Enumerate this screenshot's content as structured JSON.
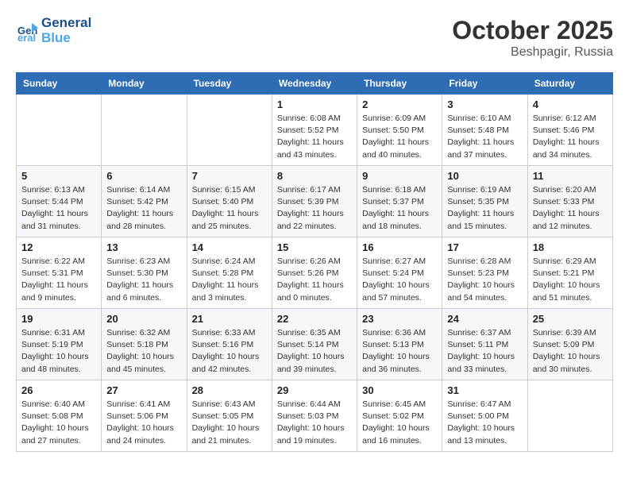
{
  "header": {
    "logo_line1": "General",
    "logo_line2": "Blue",
    "month_title": "October 2025",
    "subtitle": "Beshpagir, Russia"
  },
  "weekdays": [
    "Sunday",
    "Monday",
    "Tuesday",
    "Wednesday",
    "Thursday",
    "Friday",
    "Saturday"
  ],
  "weeks": [
    [
      {
        "day": "",
        "info": ""
      },
      {
        "day": "",
        "info": ""
      },
      {
        "day": "",
        "info": ""
      },
      {
        "day": "1",
        "info": "Sunrise: 6:08 AM\nSunset: 5:52 PM\nDaylight: 11 hours\nand 43 minutes."
      },
      {
        "day": "2",
        "info": "Sunrise: 6:09 AM\nSunset: 5:50 PM\nDaylight: 11 hours\nand 40 minutes."
      },
      {
        "day": "3",
        "info": "Sunrise: 6:10 AM\nSunset: 5:48 PM\nDaylight: 11 hours\nand 37 minutes."
      },
      {
        "day": "4",
        "info": "Sunrise: 6:12 AM\nSunset: 5:46 PM\nDaylight: 11 hours\nand 34 minutes."
      }
    ],
    [
      {
        "day": "5",
        "info": "Sunrise: 6:13 AM\nSunset: 5:44 PM\nDaylight: 11 hours\nand 31 minutes."
      },
      {
        "day": "6",
        "info": "Sunrise: 6:14 AM\nSunset: 5:42 PM\nDaylight: 11 hours\nand 28 minutes."
      },
      {
        "day": "7",
        "info": "Sunrise: 6:15 AM\nSunset: 5:40 PM\nDaylight: 11 hours\nand 25 minutes."
      },
      {
        "day": "8",
        "info": "Sunrise: 6:17 AM\nSunset: 5:39 PM\nDaylight: 11 hours\nand 22 minutes."
      },
      {
        "day": "9",
        "info": "Sunrise: 6:18 AM\nSunset: 5:37 PM\nDaylight: 11 hours\nand 18 minutes."
      },
      {
        "day": "10",
        "info": "Sunrise: 6:19 AM\nSunset: 5:35 PM\nDaylight: 11 hours\nand 15 minutes."
      },
      {
        "day": "11",
        "info": "Sunrise: 6:20 AM\nSunset: 5:33 PM\nDaylight: 11 hours\nand 12 minutes."
      }
    ],
    [
      {
        "day": "12",
        "info": "Sunrise: 6:22 AM\nSunset: 5:31 PM\nDaylight: 11 hours\nand 9 minutes."
      },
      {
        "day": "13",
        "info": "Sunrise: 6:23 AM\nSunset: 5:30 PM\nDaylight: 11 hours\nand 6 minutes."
      },
      {
        "day": "14",
        "info": "Sunrise: 6:24 AM\nSunset: 5:28 PM\nDaylight: 11 hours\nand 3 minutes."
      },
      {
        "day": "15",
        "info": "Sunrise: 6:26 AM\nSunset: 5:26 PM\nDaylight: 11 hours\nand 0 minutes."
      },
      {
        "day": "16",
        "info": "Sunrise: 6:27 AM\nSunset: 5:24 PM\nDaylight: 10 hours\nand 57 minutes."
      },
      {
        "day": "17",
        "info": "Sunrise: 6:28 AM\nSunset: 5:23 PM\nDaylight: 10 hours\nand 54 minutes."
      },
      {
        "day": "18",
        "info": "Sunrise: 6:29 AM\nSunset: 5:21 PM\nDaylight: 10 hours\nand 51 minutes."
      }
    ],
    [
      {
        "day": "19",
        "info": "Sunrise: 6:31 AM\nSunset: 5:19 PM\nDaylight: 10 hours\nand 48 minutes."
      },
      {
        "day": "20",
        "info": "Sunrise: 6:32 AM\nSunset: 5:18 PM\nDaylight: 10 hours\nand 45 minutes."
      },
      {
        "day": "21",
        "info": "Sunrise: 6:33 AM\nSunset: 5:16 PM\nDaylight: 10 hours\nand 42 minutes."
      },
      {
        "day": "22",
        "info": "Sunrise: 6:35 AM\nSunset: 5:14 PM\nDaylight: 10 hours\nand 39 minutes."
      },
      {
        "day": "23",
        "info": "Sunrise: 6:36 AM\nSunset: 5:13 PM\nDaylight: 10 hours\nand 36 minutes."
      },
      {
        "day": "24",
        "info": "Sunrise: 6:37 AM\nSunset: 5:11 PM\nDaylight: 10 hours\nand 33 minutes."
      },
      {
        "day": "25",
        "info": "Sunrise: 6:39 AM\nSunset: 5:09 PM\nDaylight: 10 hours\nand 30 minutes."
      }
    ],
    [
      {
        "day": "26",
        "info": "Sunrise: 6:40 AM\nSunset: 5:08 PM\nDaylight: 10 hours\nand 27 minutes."
      },
      {
        "day": "27",
        "info": "Sunrise: 6:41 AM\nSunset: 5:06 PM\nDaylight: 10 hours\nand 24 minutes."
      },
      {
        "day": "28",
        "info": "Sunrise: 6:43 AM\nSunset: 5:05 PM\nDaylight: 10 hours\nand 21 minutes."
      },
      {
        "day": "29",
        "info": "Sunrise: 6:44 AM\nSunset: 5:03 PM\nDaylight: 10 hours\nand 19 minutes."
      },
      {
        "day": "30",
        "info": "Sunrise: 6:45 AM\nSunset: 5:02 PM\nDaylight: 10 hours\nand 16 minutes."
      },
      {
        "day": "31",
        "info": "Sunrise: 6:47 AM\nSunset: 5:00 PM\nDaylight: 10 hours\nand 13 minutes."
      },
      {
        "day": "",
        "info": ""
      }
    ]
  ]
}
